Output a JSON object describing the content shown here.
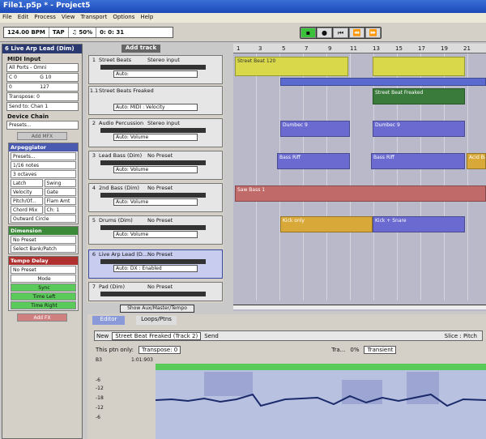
{
  "window": {
    "title": "File1.p5p * - Project5"
  },
  "menu": [
    "File",
    "Edit",
    "Process",
    "View",
    "Transport",
    "Options",
    "Help"
  ],
  "toolbar": {
    "tempo": "124.00 BPM",
    "tap": "TAP",
    "swing": "♫ 50%",
    "time": "0:  0:  31"
  },
  "left": {
    "track_title": "Live Arp Lead (Dim)",
    "track_num": "6",
    "midi_input": "MIDI Input",
    "ports": "All Ports - Omni",
    "range_lo": "C 0",
    "range_hi": "G 10",
    "vel_lo": "0",
    "vel_hi": "127",
    "transpose": "Transpose: 0",
    "send": "Send to: Chan 1",
    "device_chain": "Device Chain",
    "presets": "Presets...",
    "add_mfx": "Add MFX",
    "arp": "Arpeggiator",
    "arp_presets": "Presets...",
    "notes": "1/16 notes",
    "octaves": "3 octaves",
    "latch": "Latch",
    "swing": "Swing",
    "velocity": "Velocity",
    "gate": "Gate",
    "pitch": "Pitch/Of...",
    "flam": "Flam Amt",
    "chord": "Chord Mix",
    "ch": "Ch: 1",
    "outward": "Outward Circle",
    "dimension": "Dimension",
    "no_preset": "No Preset",
    "select_bank": "Select Bank/Patch",
    "tempo_delay": "Tempo Delay",
    "no_preset2": "No Preset",
    "mode": "Mode",
    "sync": "Sync",
    "time_left": "Time Left",
    "time_right": "Time Right",
    "add_fx": "Add FX"
  },
  "tracks": {
    "add": "Add track",
    "show": "Show Aux/Master/Tempo",
    "list": [
      {
        "num": "1",
        "name": "Street Beats",
        "preset": "Stereo input",
        "sel": "Auto:"
      },
      {
        "num": "1.1",
        "name": "Street Beats Freaked",
        "preset": "",
        "sel": "Auto: MIDI : Velocity"
      },
      {
        "num": "2",
        "name": "Audio Percussion",
        "preset": "Stereo input",
        "sel": "Auto: Volume"
      },
      {
        "num": "3",
        "name": "Lead Bass (Dim)",
        "preset": "No Preset",
        "sel": "Auto: Volume"
      },
      {
        "num": "4",
        "name": "2nd Bass (Dim)",
        "preset": "No Preset",
        "sel": "Auto: Volume"
      },
      {
        "num": "5",
        "name": "Drums (Dim)",
        "preset": "No Preset",
        "sel": "Auto: Volume"
      },
      {
        "num": "6",
        "name": "Live Arp Lead (D...",
        "preset": "No Preset",
        "sel": "Auto: DX : Enabled"
      },
      {
        "num": "7",
        "name": "Pad (Dim)",
        "preset": "No Preset",
        "sel": ""
      }
    ]
  },
  "arrange": {
    "ruler": [
      "1",
      "3",
      "5",
      "7",
      "9",
      "11",
      "13",
      "15",
      "17",
      "19",
      "21"
    ],
    "clips": {
      "c1": "Street Beat 120",
      "c2": "Street Beat Freaked",
      "c3": "Dumbec 9",
      "c4": "Dumbec 9",
      "c5": "Bass Riff",
      "c6": "Bass Riff",
      "c7": "Acid Bas",
      "c8": "Saw Bass 1",
      "c9": "Kick only",
      "c10": "Kick + Snare"
    }
  },
  "editor": {
    "tab1": "Editor",
    "tab2": "Loops/Ptns",
    "new": "New",
    "pattern": "Street Beat Freaked (Track 2)",
    "send": "Send",
    "slice": "Slice : Pitch",
    "this_ptn": "This ptn only:",
    "transpose": "Transpose: 0",
    "tra": "Tra...",
    "pct": "0%",
    "transient": "Transient",
    "b3": "B3",
    "pos": "1:01:903",
    "db": [
      "-6",
      "-12",
      "-18",
      "-12",
      "-6"
    ]
  },
  "colors": {
    "yellow": "#d8d84a",
    "blue": "#6a6ad0",
    "green": "#3a7a3a",
    "red": "#c06a6a",
    "orange": "#d8a838"
  }
}
